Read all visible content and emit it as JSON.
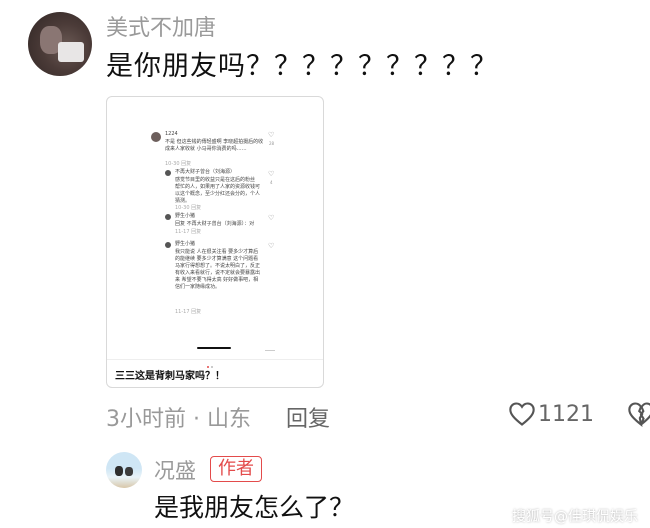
{
  "comment": {
    "username": "美式不加唐",
    "text": "是你朋友吗？？？？？？？？？",
    "time_location": "3小时前 · 山东",
    "reply_label": "回复",
    "like_count": "1121",
    "like_icon": "heart-outline-icon",
    "dislike_icon": "broken-heart-icon"
  },
  "embedded_screenshot": {
    "caption": "三三这是背刺马家吗？！",
    "rows": [
      {
        "user": "1224",
        "text": "不是 但这些钱的傳轻盛啊 李晓超拍摄后的收成来人家收就 小马哥你消费的吗……",
        "meta": "10-30 回复"
      },
      {
        "user": "不再大财子曾台（刘海源）",
        "text": "感觉节目里的收益只是在这后的粉丝 帮忙的人，如果用了人家的资源收钱可以这个概念，至少分红还会分的，个人猜测。",
        "meta": "10-30 回复"
      },
      {
        "user": "野生小猪",
        "text": "回复 不再大财子曾台（刘海源）：对",
        "meta": "11-17 回复"
      },
      {
        "user": "野生小猪",
        "text": "我只能说 人在很关注看 要多少才算后的能继续 要多少才算满意 这个问题看马家行得想想了。不说太明白了，反正有收入来看就行，说不定就会要暴露出来 希望不要飞得太高 好好做事吧，相信们一家随缘成功。",
        "meta": "11-17 回复"
      }
    ],
    "like_counts": [
      "28",
      "4"
    ]
  },
  "reply": {
    "username": "况盛",
    "badge": "作者",
    "text": "是我朋友怎么了？"
  },
  "watermark": "搜狐号@佳琪侃娱乐",
  "colors": {
    "accent_red": "#e34b4b",
    "muted_gray": "#999999"
  }
}
